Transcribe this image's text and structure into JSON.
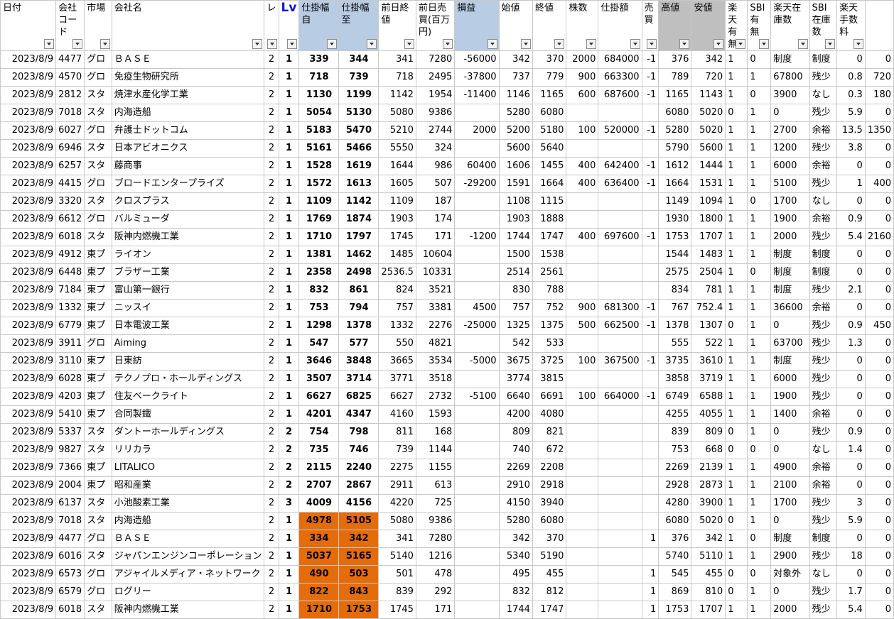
{
  "headers": [
    "日付",
    "会社コード",
    "市場",
    "会社名",
    "レ",
    "Lv",
    "仕掛幅自",
    "仕掛幅至",
    "前日終値",
    "前日売買(百万円)",
    "損益",
    "始値",
    "終値",
    "株数",
    "仕掛額",
    "売買",
    "高値",
    "安値",
    "楽天有無",
    "SBI有無",
    "楽天在庫数",
    "SBI在庫数",
    "楽天手数料",
    ""
  ],
  "rows": [
    [
      "2023/8/9",
      "4477",
      "グロ",
      "ＢＡＳＥ",
      "2",
      "1",
      "339",
      "344",
      "341",
      "7280",
      "-56000",
      "342",
      "370",
      "2000",
      "684000",
      "-1",
      "376",
      "342",
      "1",
      "0",
      "制度",
      "制度",
      "0",
      "0"
    ],
    [
      "2023/8/9",
      "4570",
      "グロ",
      "免疫生物研究所",
      "2",
      "1",
      "718",
      "739",
      "718",
      "2495",
      "-37800",
      "737",
      "779",
      "900",
      "663300",
      "-1",
      "789",
      "720",
      "1",
      "1",
      "67800",
      "残少",
      "0.8",
      "720"
    ],
    [
      "2023/8/9",
      "2812",
      "スタ",
      "焼津水産化学工業",
      "2",
      "1",
      "1130",
      "1199",
      "1142",
      "1954",
      "-11400",
      "1146",
      "1165",
      "600",
      "687600",
      "-1",
      "1165",
      "1143",
      "1",
      "0",
      "3900",
      "なし",
      "0.3",
      "180"
    ],
    [
      "2023/8/9",
      "7018",
      "スタ",
      "内海造船",
      "2",
      "1",
      "5054",
      "5130",
      "5080",
      "9386",
      "",
      "5280",
      "6080",
      "",
      "",
      "",
      "6080",
      "5020",
      "0",
      "1",
      "0",
      "残少",
      "5.9",
      "0"
    ],
    [
      "2023/8/9",
      "6027",
      "グロ",
      "弁護士ドットコム",
      "2",
      "1",
      "5183",
      "5470",
      "5210",
      "2744",
      "2000",
      "5200",
      "5180",
      "100",
      "520000",
      "-1",
      "5280",
      "5020",
      "1",
      "1",
      "2700",
      "余裕",
      "13.5",
      "1350"
    ],
    [
      "2023/8/9",
      "6946",
      "スタ",
      "日本アビオニクス",
      "2",
      "1",
      "5161",
      "5466",
      "5550",
      "324",
      "",
      "5600",
      "5640",
      "",
      "",
      "",
      "5790",
      "5600",
      "1",
      "1",
      "1200",
      "残少",
      "3.8",
      "0"
    ],
    [
      "2023/8/9",
      "6257",
      "スタ",
      "藤商事",
      "2",
      "1",
      "1528",
      "1619",
      "1644",
      "986",
      "60400",
      "1606",
      "1455",
      "400",
      "642400",
      "-1",
      "1612",
      "1444",
      "1",
      "1",
      "6000",
      "余裕",
      "0",
      "0"
    ],
    [
      "2023/8/9",
      "4415",
      "グロ",
      "ブロードエンタープライズ",
      "2",
      "1",
      "1572",
      "1613",
      "1605",
      "507",
      "-29200",
      "1591",
      "1664",
      "400",
      "636400",
      "-1",
      "1664",
      "1531",
      "1",
      "1",
      "5100",
      "残少",
      "1",
      "400"
    ],
    [
      "2023/8/9",
      "3320",
      "スタ",
      "クロスプラス",
      "2",
      "1",
      "1109",
      "1142",
      "1109",
      "187",
      "",
      "1108",
      "1115",
      "",
      "",
      "",
      "1149",
      "1094",
      "1",
      "0",
      "1700",
      "なし",
      "0",
      "0"
    ],
    [
      "2023/8/9",
      "6612",
      "グロ",
      "バルミューダ",
      "2",
      "1",
      "1769",
      "1874",
      "1903",
      "174",
      "",
      "1903",
      "1888",
      "",
      "",
      "",
      "1930",
      "1800",
      "1",
      "1",
      "1900",
      "余裕",
      "0.9",
      "0"
    ],
    [
      "2023/8/9",
      "6018",
      "スタ",
      "阪神内燃機工業",
      "2",
      "1",
      "1710",
      "1797",
      "1745",
      "171",
      "-1200",
      "1744",
      "1747",
      "400",
      "697600",
      "-1",
      "1753",
      "1707",
      "1",
      "1",
      "2000",
      "残少",
      "5.4",
      "2160"
    ],
    [
      "2023/8/9",
      "4912",
      "東プ",
      "ライオン",
      "2",
      "1",
      "1381",
      "1462",
      "1485",
      "10604",
      "",
      "1500",
      "1538",
      "",
      "",
      "",
      "1544",
      "1483",
      "1",
      "1",
      "制度",
      "制度",
      "0",
      "0"
    ],
    [
      "2023/8/9",
      "6448",
      "東プ",
      "ブラザー工業",
      "2",
      "1",
      "2358",
      "2498",
      "2536.5",
      "10331",
      "",
      "2514",
      "2561",
      "",
      "",
      "",
      "2575",
      "2504",
      "1",
      "0",
      "制度",
      "制度",
      "0",
      "0"
    ],
    [
      "2023/8/9",
      "7184",
      "東プ",
      "富山第一銀行",
      "2",
      "1",
      "832",
      "861",
      "824",
      "3521",
      "",
      "830",
      "788",
      "",
      "",
      "",
      "834",
      "781",
      "1",
      "1",
      "制度",
      "残少",
      "2.1",
      "0"
    ],
    [
      "2023/8/9",
      "1332",
      "東プ",
      "ニッスイ",
      "2",
      "1",
      "753",
      "794",
      "757",
      "3381",
      "4500",
      "757",
      "752",
      "900",
      "681300",
      "-1",
      "767",
      "752.4",
      "1",
      "1",
      "36600",
      "余裕",
      "0",
      "0"
    ],
    [
      "2023/8/9",
      "6779",
      "東プ",
      "日本電波工業",
      "2",
      "1",
      "1298",
      "1378",
      "1332",
      "2276",
      "-25000",
      "1325",
      "1375",
      "500",
      "662500",
      "-1",
      "1378",
      "1307",
      "0",
      "1",
      "0",
      "残少",
      "0.9",
      "450"
    ],
    [
      "2023/8/9",
      "3911",
      "グロ",
      "Aiming",
      "2",
      "1",
      "547",
      "577",
      "550",
      "4821",
      "",
      "542",
      "533",
      "",
      "",
      "",
      "555",
      "522",
      "1",
      "1",
      "63700",
      "残少",
      "1.3",
      "0"
    ],
    [
      "2023/8/9",
      "3110",
      "東プ",
      "日東紡",
      "2",
      "1",
      "3646",
      "3848",
      "3665",
      "3534",
      "-5000",
      "3675",
      "3725",
      "100",
      "367500",
      "-1",
      "3735",
      "3610",
      "1",
      "1",
      "制度",
      "残少",
      "0",
      "0"
    ],
    [
      "2023/8/9",
      "6028",
      "東プ",
      "テクノプロ・ホールディングス",
      "2",
      "1",
      "3507",
      "3714",
      "3771",
      "3518",
      "",
      "3774",
      "3815",
      "",
      "",
      "",
      "3858",
      "3719",
      "1",
      "1",
      "6000",
      "残少",
      "0",
      "0"
    ],
    [
      "2023/8/9",
      "4203",
      "東プ",
      "住友ベークライト",
      "2",
      "1",
      "6627",
      "6825",
      "6627",
      "2732",
      "-5100",
      "6640",
      "6691",
      "100",
      "664000",
      "-1",
      "6749",
      "6588",
      "1",
      "1",
      "1900",
      "残少",
      "0",
      "0"
    ],
    [
      "2023/8/9",
      "5410",
      "東プ",
      "合同製鐵",
      "2",
      "1",
      "4201",
      "4347",
      "4160",
      "1593",
      "",
      "4200",
      "4080",
      "",
      "",
      "",
      "4255",
      "4055",
      "1",
      "1",
      "1400",
      "余裕",
      "0",
      "0"
    ],
    [
      "2023/8/9",
      "5337",
      "スタ",
      "ダントーホールディングス",
      "2",
      "2",
      "754",
      "798",
      "811",
      "168",
      "",
      "809",
      "821",
      "",
      "",
      "",
      "839",
      "809",
      "0",
      "1",
      "0",
      "残少",
      "0.9",
      "0"
    ],
    [
      "2023/8/9",
      "9827",
      "スタ",
      "リリカラ",
      "2",
      "2",
      "735",
      "746",
      "739",
      "1144",
      "",
      "740",
      "672",
      "",
      "",
      "",
      "753",
      "668",
      "0",
      "0",
      "0",
      "なし",
      "1.4",
      "0"
    ],
    [
      "2023/8/9",
      "7366",
      "東プ",
      "LITALICO",
      "2",
      "2",
      "2115",
      "2240",
      "2275",
      "1155",
      "",
      "2269",
      "2208",
      "",
      "",
      "",
      "2269",
      "2139",
      "1",
      "1",
      "4900",
      "余裕",
      "0",
      "0"
    ],
    [
      "2023/8/9",
      "2004",
      "東プ",
      "昭和産業",
      "2",
      "2",
      "2707",
      "2867",
      "2911",
      "613",
      "",
      "2910",
      "2918",
      "",
      "",
      "",
      "2928",
      "2873",
      "1",
      "1",
      "2100",
      "余裕",
      "0",
      "0"
    ],
    [
      "2023/8/9",
      "6137",
      "スタ",
      "小池酸素工業",
      "2",
      "3",
      "4009",
      "4156",
      "4220",
      "725",
      "",
      "4150",
      "3940",
      "",
      "",
      "",
      "4280",
      "3900",
      "1",
      "1",
      "1700",
      "残少",
      "3",
      "0"
    ],
    [
      "2023/8/9",
      "7018",
      "スタ",
      "内海造船",
      "2",
      "1",
      "4978",
      "5105",
      "5080",
      "9386",
      "",
      "5280",
      "6080",
      "",
      "",
      "",
      "6080",
      "5020",
      "0",
      "1",
      "0",
      "残少",
      "5.9",
      "0"
    ],
    [
      "2023/8/9",
      "4477",
      "グロ",
      "ＢＡＳＥ",
      "2",
      "1",
      "334",
      "342",
      "341",
      "7280",
      "",
      "342",
      "370",
      "",
      "",
      "1",
      "376",
      "342",
      "1",
      "0",
      "制度",
      "制度",
      "0",
      "0"
    ],
    [
      "2023/8/9",
      "6016",
      "スタ",
      "ジャパンエンジンコーポレーション",
      "2",
      "1",
      "5037",
      "5165",
      "5140",
      "1216",
      "",
      "5340",
      "5190",
      "",
      "",
      "",
      "5740",
      "5110",
      "1",
      "1",
      "2900",
      "残少",
      "18",
      "0"
    ],
    [
      "2023/8/9",
      "6573",
      "グロ",
      "アジャイルメディア・ネットワーク",
      "2",
      "1",
      "490",
      "503",
      "501",
      "478",
      "",
      "495",
      "455",
      "",
      "",
      "1",
      "545",
      "455",
      "0",
      "0",
      "対象外",
      "なし",
      "0",
      "0"
    ],
    [
      "2023/8/9",
      "6579",
      "グロ",
      "ログリー",
      "2",
      "1",
      "822",
      "843",
      "839",
      "292",
      "",
      "832",
      "812",
      "",
      "",
      "1",
      "869",
      "810",
      "0",
      "1",
      "0",
      "残少",
      "1.7",
      "0"
    ],
    [
      "2023/8/9",
      "6018",
      "スタ",
      "阪神内燃機工業",
      "2",
      "1",
      "1710",
      "1753",
      "1745",
      "171",
      "",
      "1744",
      "1747",
      "",
      "",
      "1",
      "1753",
      "1707",
      "1",
      "1",
      "2000",
      "残少",
      "5.4",
      "0"
    ]
  ],
  "highlighted_rows": [
    26,
    27,
    28,
    29,
    30,
    31
  ],
  "colors": {
    "highlight_orange": "#e46c0a",
    "header_blue": "#b8cce4",
    "header_gray": "#bfbfbf",
    "lv_blue": "#1414d2"
  }
}
